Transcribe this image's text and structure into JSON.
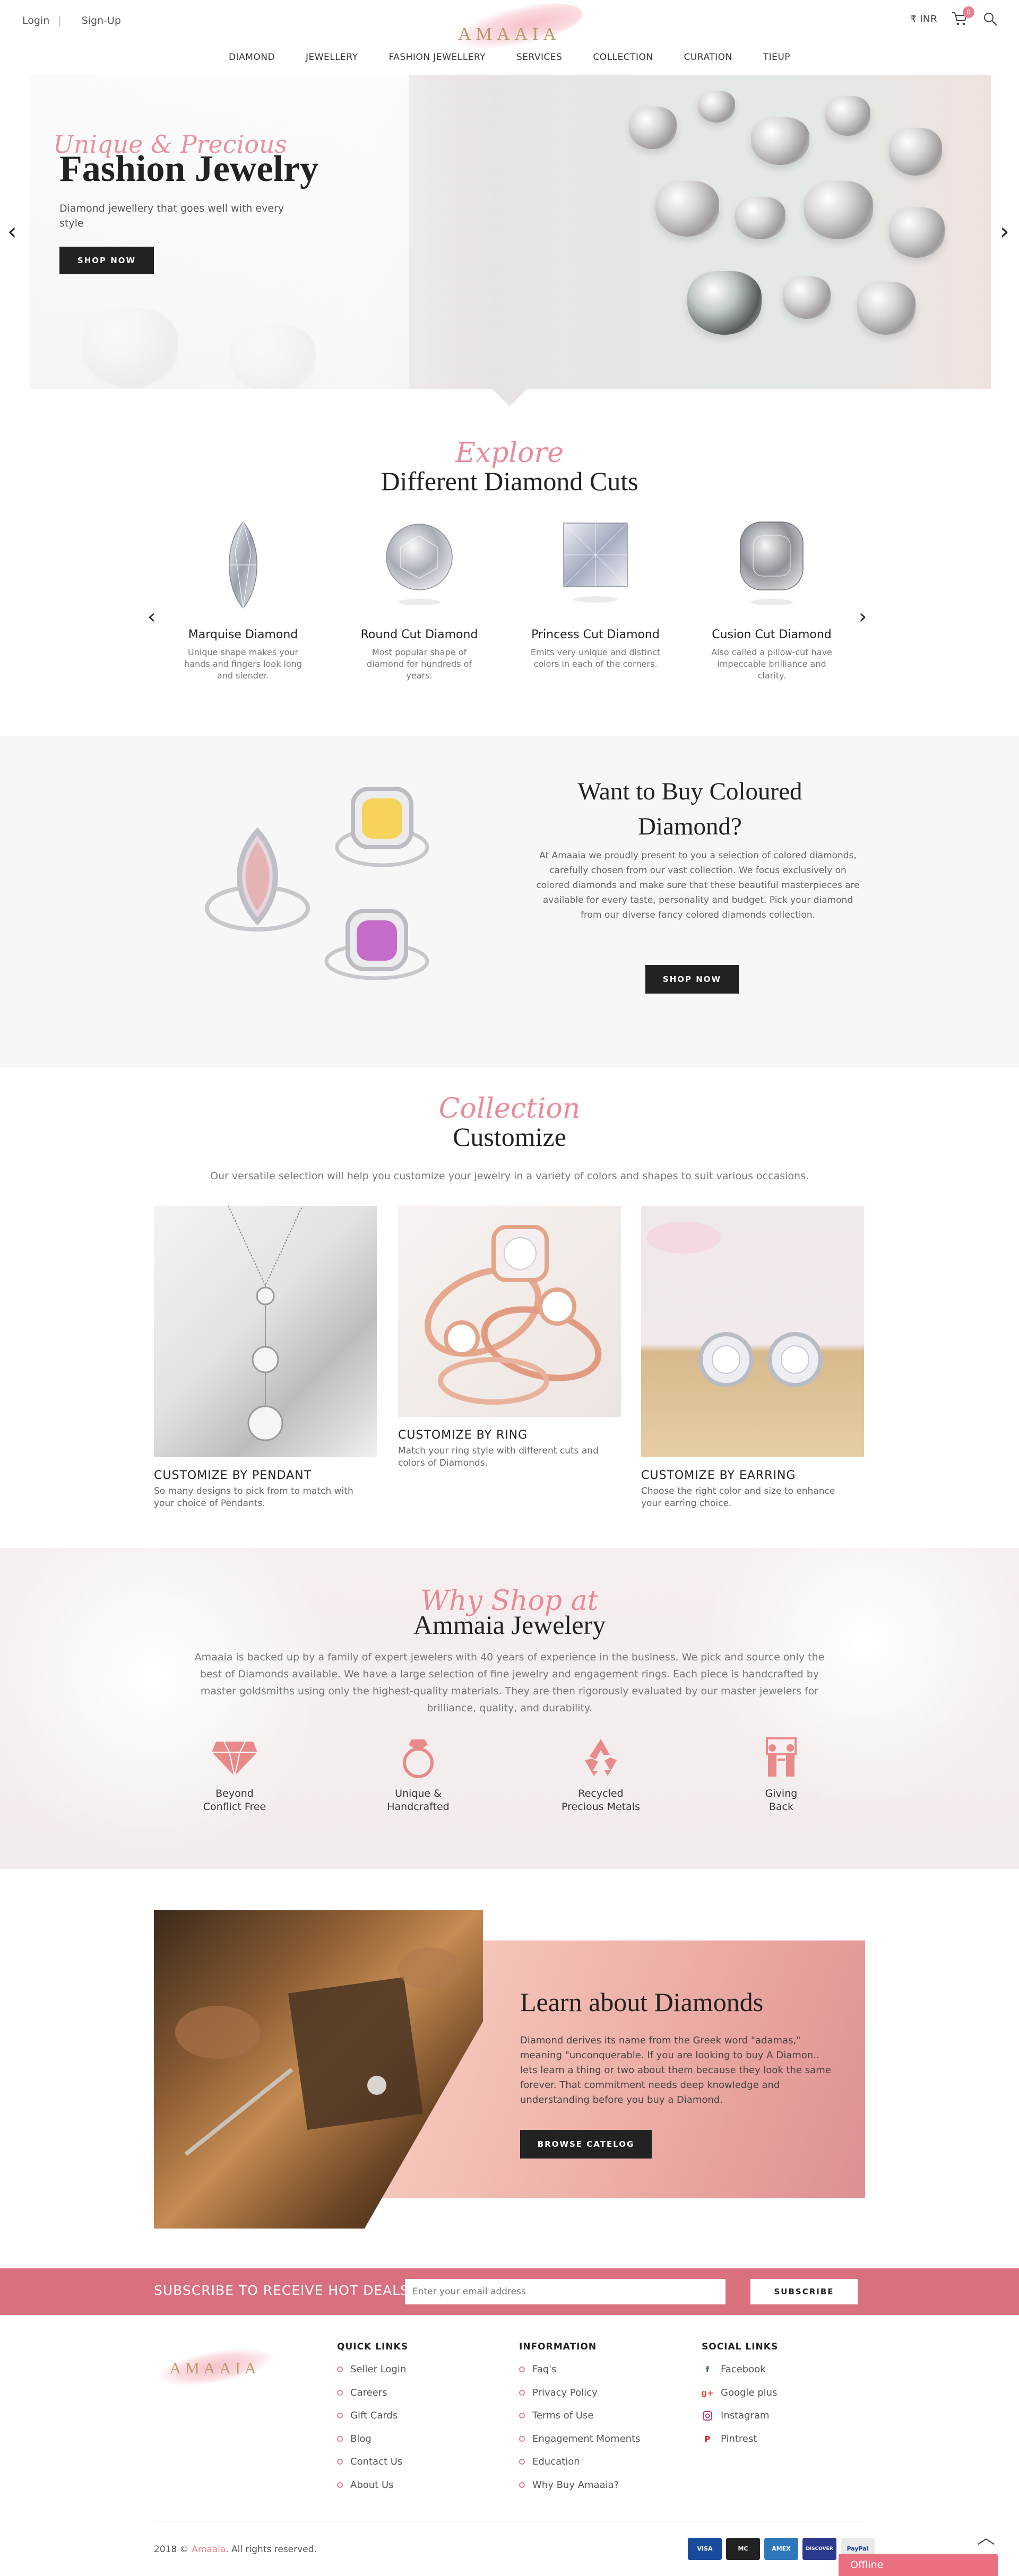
{
  "header": {
    "login": "Login",
    "separator": "|",
    "signup": "Sign-Up",
    "logo": "AMAAIA",
    "currency": "₹ INR",
    "cart_count": "0"
  },
  "nav": [
    "DIAMOND",
    "JEWELLERY",
    "FASHION JEWELLERY",
    "SERVICES",
    "COLLECTION",
    "CURATION",
    "TIEUP"
  ],
  "hero": {
    "script": "Unique & Precious",
    "title": "Fashion Jewelry",
    "subtitle": "Diamond jewellery that goes well with every style",
    "button": "SHOP NOW",
    "prev": "‹",
    "next": "›"
  },
  "cuts": {
    "script": "Explore",
    "title": "Different Diamond Cuts",
    "prev": "‹",
    "next": "›",
    "items": [
      {
        "name": "Marquise Diamond",
        "desc": "Unique shape makes your hands and fingers look long and slender."
      },
      {
        "name": "Round Cut Diamond",
        "desc": "Most popular shape of diamond for hundreds of years."
      },
      {
        "name": "Princess Cut Diamond",
        "desc": "Emits very unique and distinct colors in each of the corners."
      },
      {
        "name": "Cusion Cut Diamond",
        "desc": "Also called a pillow-cut have impeccable brilliance and clarity."
      }
    ]
  },
  "coloured": {
    "title": "Want to Buy Coloured Diamond?",
    "desc": "At Amaaia we proudly present to you a selection of colored diamonds, carefully chosen from our vast collection. We focus exclusively on colored diamonds and make sure that these beautiful masterpieces are available for every taste, personality and budget. Pick your diamond from our diverse fancy colored diamonds collection.",
    "button": "SHOP NOW"
  },
  "customize": {
    "script": "Collection",
    "title": "Customize",
    "intro": "Our versatile selection will help you customize your jewelry in a variety of colors and shapes to suit various occasions.",
    "items": [
      {
        "title": "CUSTOMIZE BY PENDANT",
        "desc": "So many designs to pick from to match with your choice of Pendants."
      },
      {
        "title": "CUSTOMIZE BY RING",
        "desc": "Match your ring style with different cuts and colors of Diamonds."
      },
      {
        "title": "CUSTOMIZE BY EARRING",
        "desc": "Choose the right color and size to enhance your earring choice."
      }
    ]
  },
  "whyshop": {
    "script": "Why Shop at",
    "title": "Ammaia Jewelery",
    "desc": "Amaaia is backed up by a family of expert jewelers with 40 years of experience in the business. We pick and source only the best of Diamonds available. We have a large selection of fine jewelry and engagement rings. Each piece is handcrafted by master goldsmiths using only the highest-quality materials. They are then rigorously evaluated by our master jewelers for brilliance, quality, and durability.",
    "items": [
      {
        "line1": "Beyond",
        "line2": "Conflict Free",
        "icon": "diamond-icon"
      },
      {
        "line1": "Unique &",
        "line2": "Handcrafted",
        "icon": "ring-icon"
      },
      {
        "line1": "Recycled",
        "line2": "Precious Metals",
        "icon": "recycle-icon"
      },
      {
        "line1": "Giving",
        "line2": "Back",
        "icon": "giving-icon"
      }
    ]
  },
  "learn": {
    "title": "Learn about Diamonds",
    "desc": "Diamond derives its name from the Greek word \"adamas,\" meaning \"unconquerable. If you are looking to buy A Diamon.. lets learn a thing or two about them because they look the same forever. That commitment needs deep knowledge and understanding before you buy a Diamond.",
    "button": "BROWSE CATELOG"
  },
  "subscribe": {
    "label": "SUBSCRIBE TO RECEIVE HOT DEALS",
    "placeholder": "Enter your email address",
    "button": "SUBSCRIBE"
  },
  "footer": {
    "logo": "AMAAIA",
    "quick_links": {
      "heading": "QUICK LINKS",
      "items": [
        "Seller Login",
        "Careers",
        "Gift Cards",
        "Blog",
        "Contact Us",
        "About Us"
      ]
    },
    "information": {
      "heading": "INFORMATION",
      "items": [
        "Faq's",
        "Privacy Policy",
        "Terms of Use",
        "Engagement Moments",
        "Education",
        "Why Buy Amaaia?"
      ]
    },
    "social": {
      "heading": "SOCIAL LINKS",
      "items": [
        "Facebook",
        "Google plus",
        "Instagram",
        "Pintrest"
      ]
    },
    "copyright_year": "2018 ©",
    "copyright_brand": "Amaaia",
    "copyright_rest": ". All rights reserved.",
    "payments": [
      "VISA",
      "MC",
      "AMEX",
      "DISCOVER",
      "PayPal"
    ],
    "scroll_top": "︿",
    "offline": "Offline"
  },
  "colors": {
    "accent": "#e7808f",
    "dark": "#222222",
    "subscribe_bar": "#d9707f"
  }
}
